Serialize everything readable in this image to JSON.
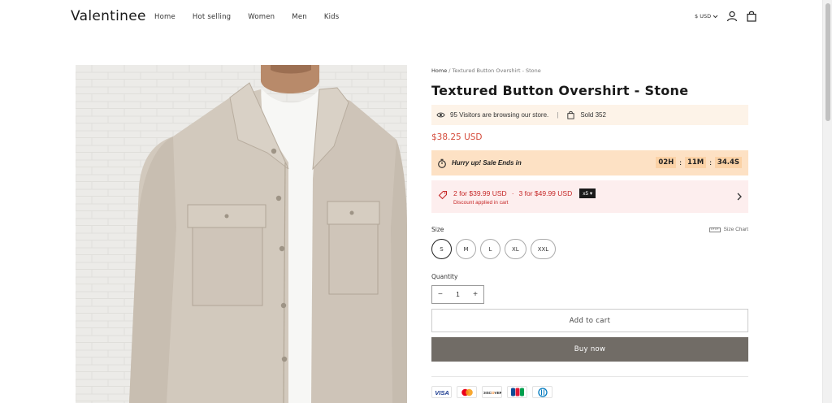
{
  "header": {
    "logo": "Valentinee",
    "nav": [
      "Home",
      "Hot selling",
      "Women",
      "Men",
      "Kids"
    ],
    "currency": "$ USD"
  },
  "breadcrumb": {
    "home": "Home",
    "separator": " / ",
    "current": "Textured Button Overshirt - Stone"
  },
  "product": {
    "title": "Textured Button Overshirt - Stone",
    "visitors_text": "95 Visitors are browsing our store.",
    "separator": "|",
    "sold_text": "Sold 352",
    "price": "$38.25 USD"
  },
  "countdown": {
    "label": "Hurry up! Sale Ends in",
    "hours": "02H",
    "minutes": "11M",
    "seconds": "34.4S",
    "colon": ":"
  },
  "discount": {
    "offer_1": "2 for $39.99 USD",
    "offer_2": "3 for $49.99 USD",
    "badge": "x5",
    "note": "Discount applied in cart"
  },
  "size": {
    "label": "Size",
    "chart_label": "Size Chart",
    "options": [
      "S",
      "M",
      "L",
      "XL",
      "XXL"
    ],
    "selected": "S"
  },
  "quantity": {
    "label": "Quantity",
    "value": "1",
    "minus": "−",
    "plus": "+"
  },
  "buttons": {
    "add_to_cart": "Add to cart",
    "buy_now": "Buy now"
  },
  "payments": [
    "visa",
    "mastercard",
    "discover",
    "jcb",
    "diners"
  ],
  "colors": {
    "accent_red": "#d44a3a",
    "buy_button": "#716c66",
    "countdown_bg": "#fde1c4",
    "discount_bg": "#fdeeee",
    "visitors_bg": "#fdf3e8"
  }
}
